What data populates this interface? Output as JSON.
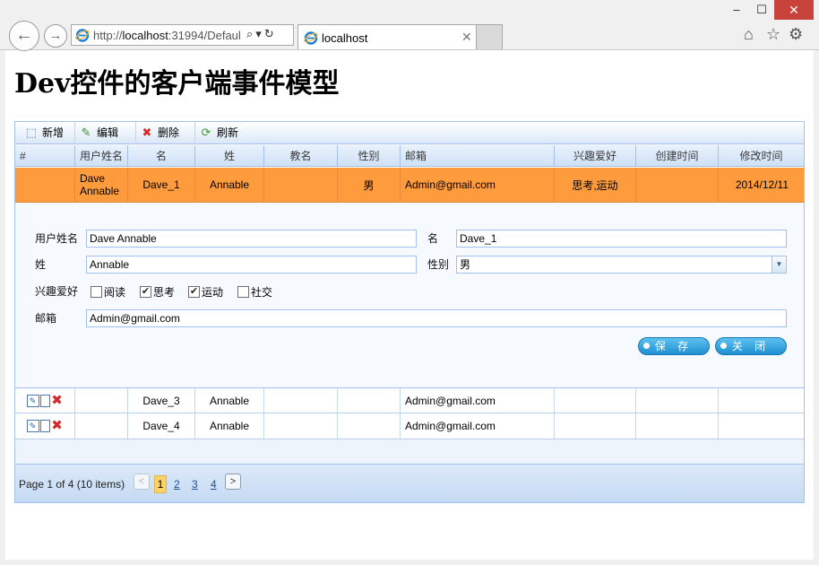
{
  "browser": {
    "window_controls": {
      "minimize": "–",
      "maximize": "☐",
      "close": "✕"
    },
    "address": {
      "prefix": "http://",
      "host": "localhost",
      "rest": ":31994/Defaul"
    },
    "tab_title": "localhost",
    "icons": [
      "back-icon",
      "forward-icon",
      "ie-icon",
      "search-icon",
      "refresh-icon",
      "home-icon",
      "star-icon",
      "gear-icon"
    ]
  },
  "page_title": "Dev控件的客户端事件模型",
  "toolbar": {
    "new_label": "新增",
    "edit_label": "编辑",
    "delete_label": "删除",
    "refresh_label": "刷新"
  },
  "grid": {
    "columns": [
      "#",
      "用户姓名",
      "名",
      "姓",
      "教名",
      "性别",
      "邮箱",
      "兴趣爱好",
      "创建时间",
      "修改时间"
    ],
    "selected_row": {
      "username_line1": "Dave",
      "username_line2": "Annable",
      "first_name": "Dave_1",
      "last_name": "Annable",
      "christian_name": "",
      "gender": "男",
      "email": "Admin@gmail.com",
      "hobbies": "思考,运动",
      "created": "",
      "modified": "2014/12/11"
    },
    "rows": [
      {
        "username": "",
        "first_name": "Dave_3",
        "last_name": "Annable",
        "christian_name": "",
        "gender": "",
        "email": "Admin@gmail.com",
        "hobbies": "",
        "created": "",
        "modified": ""
      },
      {
        "username": "",
        "first_name": "Dave_4",
        "last_name": "Annable",
        "christian_name": "",
        "gender": "",
        "email": "Admin@gmail.com",
        "hobbies": "",
        "created": "",
        "modified": ""
      }
    ]
  },
  "edit_form": {
    "username_label": "用户姓名",
    "username_value": "Dave Annable",
    "first_name_label": "名",
    "first_name_value": "Dave_1",
    "last_name_label": "姓",
    "last_name_value": "Annable",
    "gender_label": "性别",
    "gender_value": "男",
    "hobbies_label": "兴趣爱好",
    "hobbies": [
      {
        "label": "阅读",
        "checked": false
      },
      {
        "label": "思考",
        "checked": true
      },
      {
        "label": "运动",
        "checked": true
      },
      {
        "label": "社交",
        "checked": false
      }
    ],
    "email_label": "邮箱",
    "email_value": "Admin@gmail.com",
    "save_label": "保 存",
    "close_label": "关 闭"
  },
  "pager": {
    "summary": "Page 1 of 4 (10 items)",
    "prev": "<",
    "next": ">",
    "pages": [
      "1",
      "2",
      "3",
      "4"
    ],
    "current_page": "1"
  }
}
